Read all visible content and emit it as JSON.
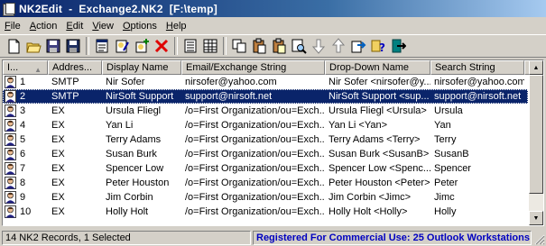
{
  "window": {
    "title": "NK2Edit  -  Exchange2.NK2  [F:\\temp]",
    "app_icon": "address-book-icon"
  },
  "menu": [
    {
      "label": "File",
      "access": "F",
      "rest": "ile"
    },
    {
      "label": "Action",
      "access": "A",
      "rest": "ction"
    },
    {
      "label": "Edit",
      "access": "E",
      "rest": "dit"
    },
    {
      "label": "View",
      "access": "V",
      "rest": "iew"
    },
    {
      "label": "Options",
      "access": "O",
      "rest": "ptions"
    },
    {
      "label": "Help",
      "access": "H",
      "rest": "elp"
    }
  ],
  "toolbar": [
    "new-file-icon",
    "open-folder-icon",
    "save-icon",
    "save-as-icon",
    "|",
    "properties-icon",
    "edit-record-icon",
    "add-record-icon",
    "delete-icon",
    "|",
    "small-view-icon",
    "grid-view-icon",
    "|",
    "copy-icon",
    "paste-icon",
    "paste-special-icon",
    "find-icon",
    "move-down-icon",
    "move-up-icon",
    "export-icon",
    "help-icon",
    "exit-icon"
  ],
  "columns": [
    "I...",
    "Addres...",
    "Display Name",
    "Email/Exchange String",
    "Drop-Down Name",
    "Search String"
  ],
  "rows": [
    {
      "index": "1",
      "type": "SMTP",
      "display": "Nir Sofer",
      "email": "nirsofer@yahoo.com",
      "dropdown": "Nir Sofer <nirsofer@y...",
      "search": "nirsofer@yahoo.com",
      "selected": false
    },
    {
      "index": "2",
      "type": "SMTP",
      "display": "NirSoft Support",
      "email": "support@nirsoft.net",
      "dropdown": "NirSoft Support <sup...",
      "search": "support@nirsoft.net",
      "selected": true
    },
    {
      "index": "3",
      "type": "EX",
      "display": "Ursula Fliegl",
      "email": "/o=First Organization/ou=Exch...",
      "dropdown": "Ursula Fliegl <Ursula>",
      "search": "Ursula",
      "selected": false
    },
    {
      "index": "4",
      "type": "EX",
      "display": "Yan Li",
      "email": "/o=First Organization/ou=Exch...",
      "dropdown": "Yan Li <Yan>",
      "search": "Yan",
      "selected": false
    },
    {
      "index": "5",
      "type": "EX",
      "display": "Terry Adams",
      "email": "/o=First Organization/ou=Exch...",
      "dropdown": "Terry Adams <Terry>",
      "search": "Terry",
      "selected": false
    },
    {
      "index": "6",
      "type": "EX",
      "display": "Susan Burk",
      "email": "/o=First Organization/ou=Exch...",
      "dropdown": "Susan Burk <SusanB>",
      "search": "SusanB",
      "selected": false
    },
    {
      "index": "7",
      "type": "EX",
      "display": "Spencer Low",
      "email": "/o=First Organization/ou=Exch...",
      "dropdown": "Spencer Low <Spenc...",
      "search": "Spencer",
      "selected": false
    },
    {
      "index": "8",
      "type": "EX",
      "display": "Peter Houston",
      "email": "/o=First Organization/ou=Exch...",
      "dropdown": "Peter Houston <Peter>",
      "search": "Peter",
      "selected": false
    },
    {
      "index": "9",
      "type": "EX",
      "display": "Jim Corbin",
      "email": "/o=First Organization/ou=Exch...",
      "dropdown": "Jim Corbin <Jimc>",
      "search": "Jimc",
      "selected": false
    },
    {
      "index": "10",
      "type": "EX",
      "display": "Holly Holt",
      "email": "/o=First Organization/ou=Exch...",
      "dropdown": "Holly Holt <Holly>",
      "search": "Holly",
      "selected": false
    }
  ],
  "status": {
    "records": "14 NK2 Records, 1 Selected",
    "license": "Registered For Commercial Use:  25 Outlook Workstations"
  },
  "colors": {
    "selection": "#0a246a",
    "title_gradient_start": "#0a246a",
    "license_text": "#0000c0"
  }
}
